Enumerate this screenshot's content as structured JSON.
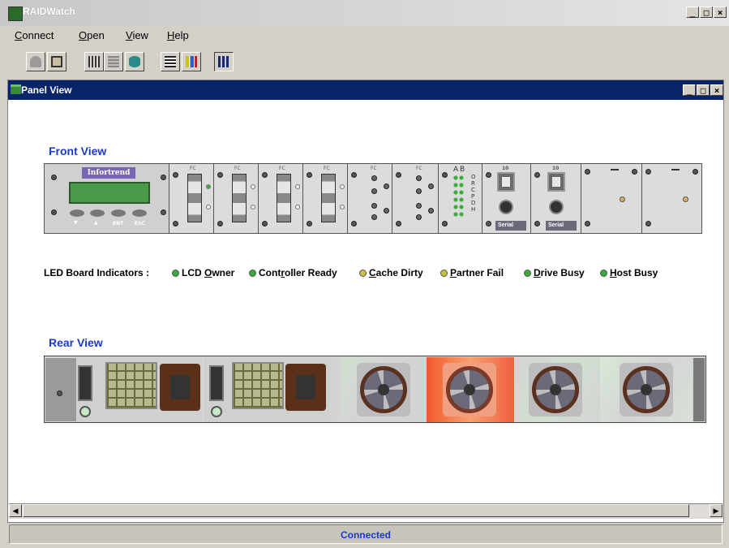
{
  "window": {
    "title": "RAIDWatch",
    "minimize": "_",
    "maximize": "□",
    "close": "×"
  },
  "menu": [
    {
      "label": "Connect",
      "mnemonic": "C"
    },
    {
      "label": "Open",
      "mnemonic": "O"
    },
    {
      "label": "View",
      "mnemonic": "V"
    },
    {
      "label": "Help",
      "mnemonic": "H"
    }
  ],
  "toolbar": {
    "icons": [
      "enclosure-view-icon",
      "connect-icon",
      "config-icon",
      "array-icon",
      "disk-icon",
      "event-log-icon",
      "statistics-icon",
      "panel-view-icon"
    ]
  },
  "panel": {
    "title": "Panel View",
    "front_title": "Front View",
    "rear_title": "Rear View",
    "brand": "Infortrend",
    "keypad": [
      "▼",
      "▲",
      "ENT",
      "ESC"
    ],
    "fc_label": "FC",
    "led_letters": [
      "A",
      "B",
      "O",
      "R",
      "C",
      "P",
      "D",
      "H"
    ],
    "serial_label": "Serial",
    "network_label": "10"
  },
  "legend": {
    "heading": "LED Board Indicators :",
    "items": [
      {
        "label": "LCD Owner",
        "mnemonic": "O",
        "color": "#3aaa3a"
      },
      {
        "label": "Controller Ready",
        "mnemonic": "r",
        "color": "#3aaa3a"
      },
      {
        "label": "Cache Dirty",
        "mnemonic": "C",
        "color": "#c8c040"
      },
      {
        "label": "Partner Fail",
        "mnemonic": "P",
        "color": "#c8c040"
      },
      {
        "label": "Drive Busy",
        "mnemonic": "D",
        "color": "#3aaa3a"
      },
      {
        "label": "Host Busy",
        "mnemonic": "H",
        "color": "#3aaa3a"
      }
    ]
  },
  "status": {
    "text": "Connected"
  },
  "colors": {
    "accent": "#1a3ac8",
    "frame_title": "#0a246a",
    "fan_alert": "#f05a2a"
  }
}
